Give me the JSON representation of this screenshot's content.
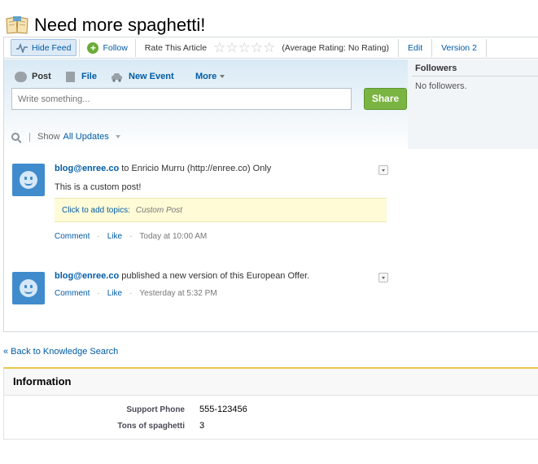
{
  "page": {
    "title": "Need more spaghetti!"
  },
  "toolbar": {
    "hide_feed": "Hide Feed",
    "follow": "Follow",
    "rate_label": "Rate This Article",
    "rating_text": "(Average Rating: No Rating)",
    "edit": "Edit",
    "version": "Version 2",
    "star_count": 5,
    "rating_value": 0
  },
  "publisher": {
    "tabs": [
      "Post",
      "File",
      "New Event"
    ],
    "more": "More",
    "placeholder": "Write something...",
    "share": "Share"
  },
  "followers": {
    "title": "Followers",
    "empty": "No followers."
  },
  "filter": {
    "show_label": "Show",
    "value": "All Updates"
  },
  "feed": [
    {
      "actor": "blog@enree.co",
      "action": " to Enricio Murru (http://enree.co) Only",
      "body": "This is a custom post!",
      "topics_link": "Click to add topics:",
      "topics_value": "Custom Post",
      "comment": "Comment",
      "like": "Like",
      "time": "Today at 10:00 AM"
    },
    {
      "actor": "blog@enree.co",
      "action": " published a new version of this European Offer.",
      "comment": "Comment",
      "like": "Like",
      "time": "Yesterday at 5:32 PM"
    }
  ],
  "back_link": "« Back to Knowledge Search",
  "information": {
    "title": "Information",
    "fields": [
      {
        "label": "Support Phone",
        "value": "555-123456"
      },
      {
        "label": "Tons of spaghetti",
        "value": "3"
      }
    ]
  },
  "colors": {
    "link": "#015ba7",
    "share_green": "#7ab442",
    "avatar_blue": "#3f8bcc",
    "topic_bg": "#fffbd7",
    "info_accent": "#e8c84a"
  }
}
